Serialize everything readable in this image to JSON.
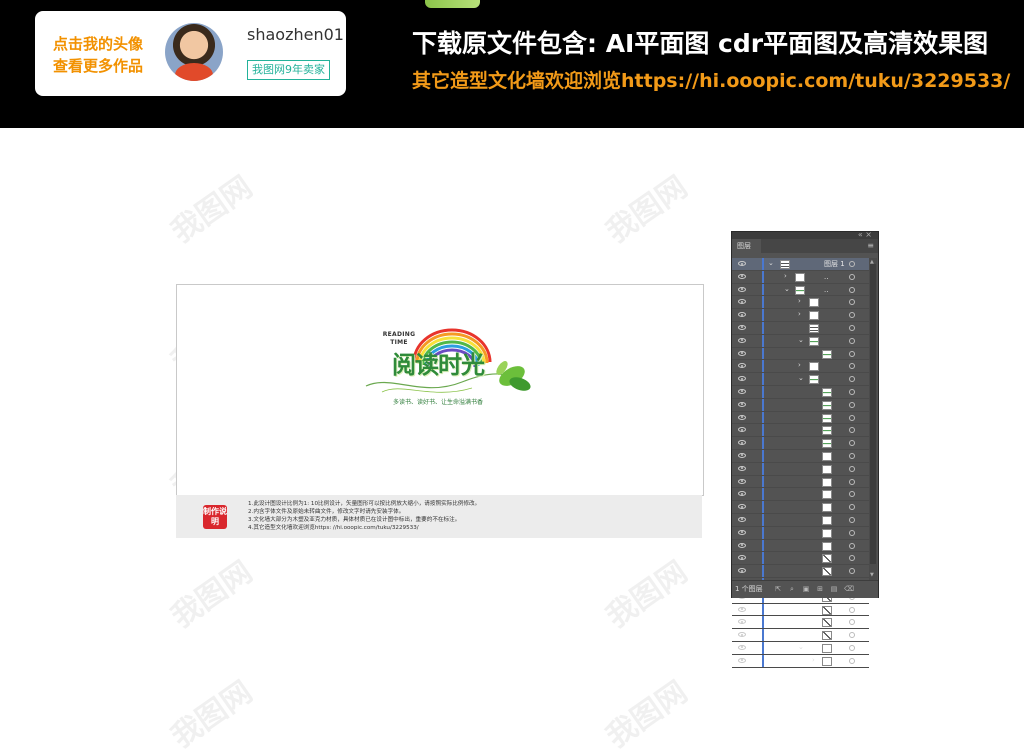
{
  "header": {
    "avatar_hint_line1": "点击我的头像",
    "avatar_hint_line2": "查看更多作品",
    "username": "shaozhen01",
    "seller_badge": "我图网9年卖家",
    "file_includes": "下载原文件包含:  AI平面图  cdr平面图及高清效果图",
    "more_link": "其它造型文化墙欢迎浏览https://hi.ooopic.com/tuku/3229533/"
  },
  "watermark_text": "我图网",
  "artwork": {
    "reading_time": "READING TIME",
    "title": "阅读时光",
    "subtitle": "多读书、读好书、让生命溢满书香"
  },
  "notes": {
    "stamp": "制作说明",
    "lines": [
      "1.此设计图设计比例为1: 10比例设计，矢量图形可以按比例放大缩小，请按照实际比例修改。",
      "2.内含字体文件及原始未转曲文件，修改文字时请先安装字体。",
      "3.文化墙大部分为木塑及亚克力材质，具体材质已在设计图中标出，重要的不在标注。",
      "4.其它造型文化墙欢迎浏览https: //hi.ooopic.com/tuku/3229533/"
    ]
  },
  "layers_panel": {
    "tab": "图层",
    "top_layer": "图层 1",
    "dots": "..",
    "layer_count": "1 个图层",
    "icons": [
      "collapse-icon",
      "menu-icon",
      "eye-icon",
      "chevron-icon",
      "target-icon",
      "export-icon",
      "search-icon",
      "clip-icon",
      "new-sublayer-icon",
      "new-layer-icon",
      "trash-icon"
    ]
  },
  "colors": {
    "header_bg": "#000000",
    "accent_orange": "#f29100",
    "badge_teal": "#23b29a",
    "panel_bg": "#535353",
    "selection_blue": "#4a78d0"
  }
}
